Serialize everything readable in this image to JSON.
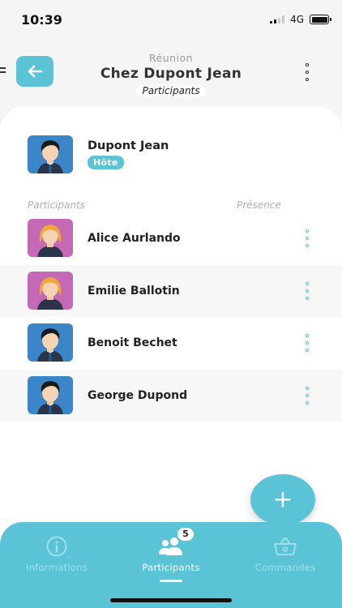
{
  "status": {
    "time": "10:39",
    "network": "4G"
  },
  "header": {
    "subtitle": "Réunion",
    "title": "Chez Dupont Jean",
    "tag": "Participants"
  },
  "host": {
    "name": "Dupont Jean",
    "badge": "Hôte",
    "avatar": "male-avatar"
  },
  "columns": {
    "participants": "Participants",
    "presence": "Présence"
  },
  "participants": [
    {
      "name": "Alice Aurlando",
      "avatar": "female-avatar"
    },
    {
      "name": "Emilie Ballotin",
      "avatar": "female-avatar"
    },
    {
      "name": "Benoit Bechet",
      "avatar": "male-avatar"
    },
    {
      "name": "George Dupond",
      "avatar": "male-avatar"
    }
  ],
  "fab": {
    "label": "+",
    "icon": "plus-icon"
  },
  "tabs": [
    {
      "label": "Informations",
      "icon": "info-icon",
      "active": false
    },
    {
      "label": "Participants",
      "icon": "group-icon",
      "active": true,
      "count": "5"
    },
    {
      "label": "Commandes",
      "icon": "basket-icon",
      "active": false
    }
  ],
  "colors": {
    "accent": "#5bc3d6",
    "male_bg": "#3a86c8",
    "female_bg": "#c568b6"
  }
}
